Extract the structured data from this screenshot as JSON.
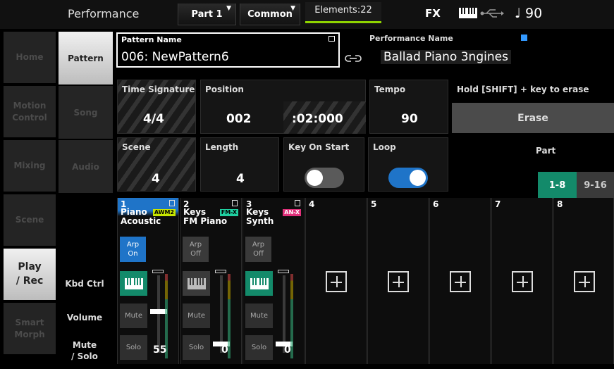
{
  "topbar": {
    "title": "Performance",
    "part_dropdown": "Part 1",
    "common_dropdown": "Common",
    "elements": "Elements:22",
    "fx": "FX",
    "tempo_display": "♩ 90"
  },
  "nav": [
    {
      "label": "Home"
    },
    {
      "label": "Motion\nControl"
    },
    {
      "label": "Mixing"
    },
    {
      "label": "Scene"
    },
    {
      "label": "Play\n/ Rec"
    },
    {
      "label": "Smart\nMorph"
    }
  ],
  "subnav": [
    {
      "label": "Pattern"
    },
    {
      "label": "Song"
    },
    {
      "label": "Audio"
    }
  ],
  "pattern": {
    "label": "Pattern Name",
    "value": "006: NewPattern6"
  },
  "performance": {
    "label": "Performance Name",
    "value": "Ballad Piano 3ngines"
  },
  "time_signature": {
    "label": "Time Signature",
    "value": "4/4"
  },
  "position": {
    "label": "Position",
    "measure": "002",
    "beat": ":02:000"
  },
  "tempo": {
    "label": "Tempo",
    "value": "90"
  },
  "erase": {
    "hint": "Hold [SHIFT] + key to erase",
    "label": "Erase"
  },
  "scene": {
    "label": "Scene",
    "value": "4"
  },
  "length": {
    "label": "Length",
    "value": "4"
  },
  "key_on_start": {
    "label": "Key On Start",
    "on": false
  },
  "loop": {
    "label": "Loop",
    "on": true
  },
  "part_select": {
    "label": "Part",
    "options": [
      "1-8",
      "9-16"
    ],
    "selected": "1-8"
  },
  "row_labels": {
    "kbd_ctrl": "Kbd Ctrl",
    "volume": "Volume",
    "mute_solo": "Mute\n/ Solo"
  },
  "parts": [
    {
      "num": "1",
      "name": "Piano\nAcoustic",
      "badge": "AWM2",
      "arp": "Arp\nOn",
      "arp_on": true,
      "kbd": true,
      "mute": "Mute",
      "solo": "Solo",
      "volume": "55"
    },
    {
      "num": "2",
      "name": "Keys\nFM Piano",
      "badge": "FM-X",
      "arp": "Arp\nOff",
      "arp_on": false,
      "kbd": false,
      "mute": "Mute",
      "solo": "Solo",
      "volume": "0"
    },
    {
      "num": "3",
      "name": "Keys\nSynth",
      "badge": "AN-X",
      "arp": "Arp\nOff",
      "arp_on": false,
      "kbd": true,
      "mute": "Mute",
      "solo": "Solo",
      "volume": "0"
    },
    {
      "num": "4"
    },
    {
      "num": "5"
    },
    {
      "num": "6"
    },
    {
      "num": "7"
    },
    {
      "num": "8"
    }
  ],
  "colors": {
    "accent_blue": "#1f74c8",
    "part_green": "#138a6a",
    "awm2": "#c7e600",
    "fmx": "#1fd0a0",
    "anx": "#e0307a"
  }
}
